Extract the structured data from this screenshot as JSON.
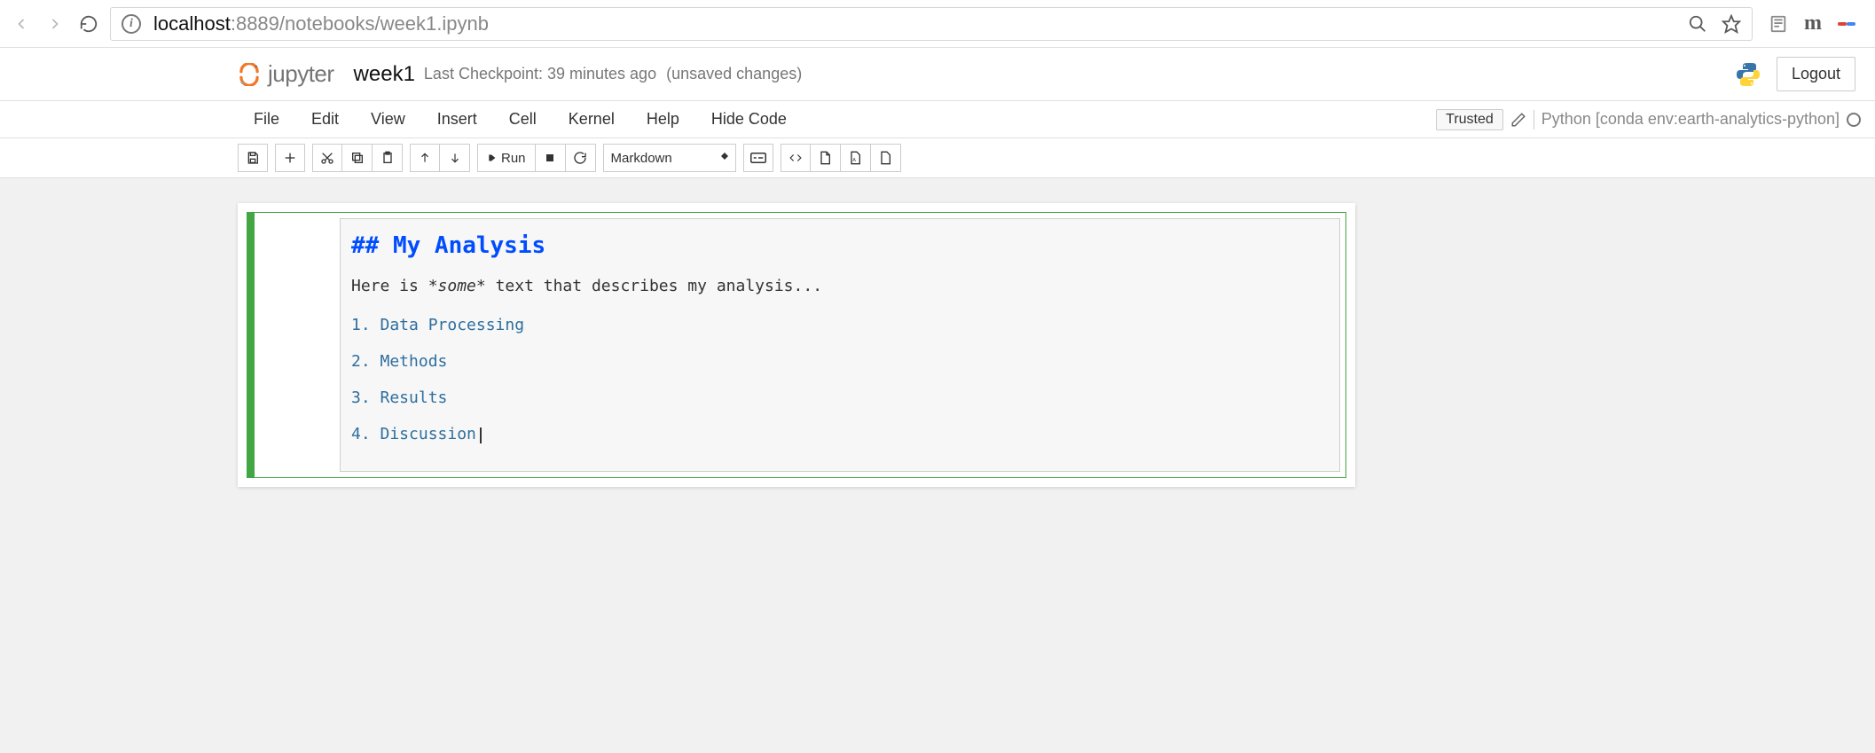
{
  "browser": {
    "url_host": "localhost",
    "url_rest": ":8889/notebooks/week1.ipynb"
  },
  "header": {
    "logo_text": "jupyter",
    "notebook_name": "week1",
    "checkpoint_text": "Last Checkpoint: 39 minutes ago",
    "unsaved_text": "(unsaved changes)",
    "logout_label": "Logout"
  },
  "menu": {
    "items": [
      "File",
      "Edit",
      "View",
      "Insert",
      "Cell",
      "Kernel",
      "Help",
      "Hide Code"
    ],
    "trusted_label": "Trusted",
    "kernel_label": "Python [conda env:earth-analytics-python]"
  },
  "toolbar": {
    "run_label": "Run",
    "cell_type": "Markdown"
  },
  "cell": {
    "heading_raw": "## My Analysis",
    "paragraph_prefix": "Here is ",
    "paragraph_italic": "*some*",
    "paragraph_suffix": " text that describes my analysis...",
    "list": [
      "1. Data Processing",
      "2. Methods",
      "3. Results",
      "4. Discussion"
    ]
  }
}
